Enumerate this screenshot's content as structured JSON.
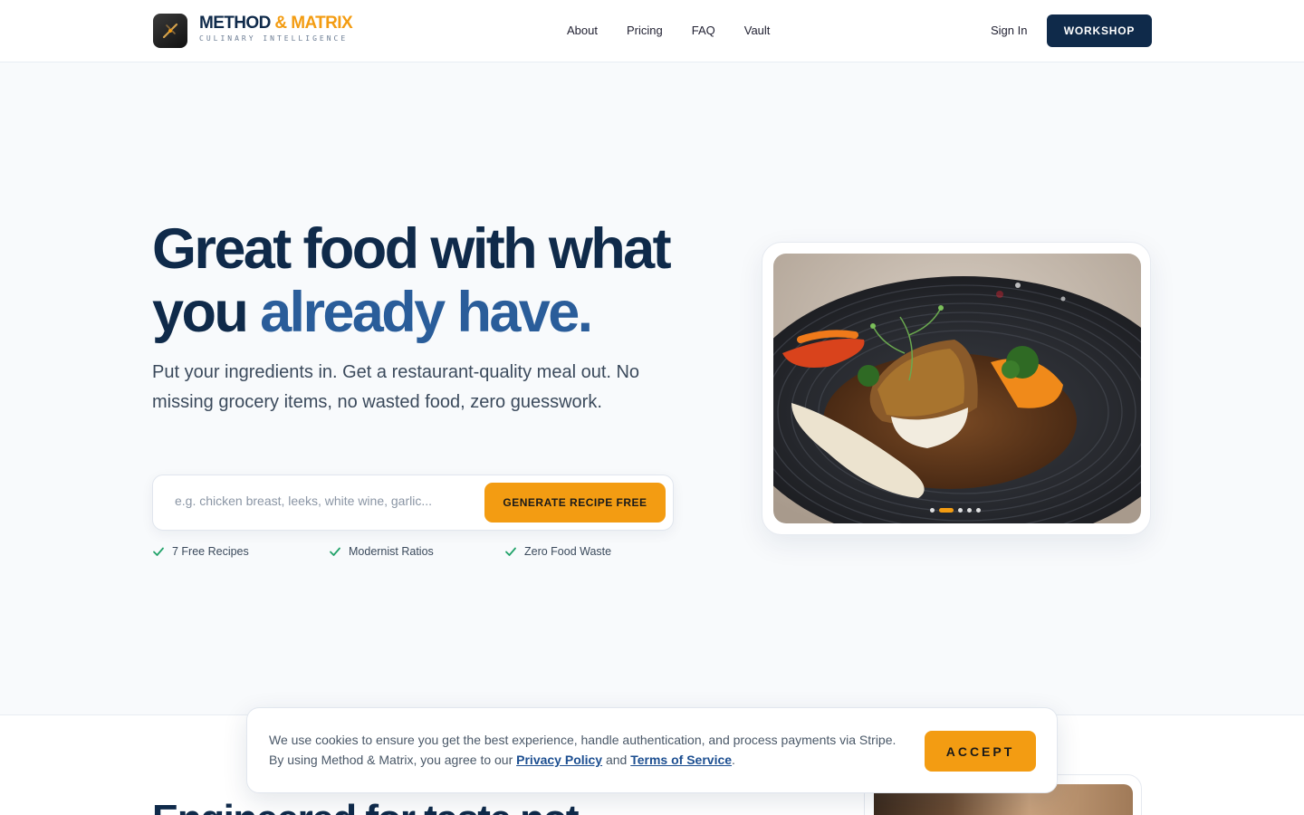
{
  "header": {
    "brand_name_main": "METHOD",
    "brand_name_amp": " & MATRIX",
    "brand_tagline": "CULINARY INTELLIGENCE",
    "nav": [
      "About",
      "Pricing",
      "FAQ",
      "Vault"
    ],
    "sign_in": "Sign In",
    "cta": "WORKSHOP"
  },
  "hero": {
    "title_line1": "Great food with what",
    "title_line2_a": "you ",
    "title_line2_b": "already have",
    "title_line2_c": ".",
    "subtitle": "Put your ingredients in. Get a restaurant-quality meal out. No missing grocery items, no wasted food, zero guesswork.",
    "search_placeholder": "e.g. chicken breast, leeks, white wine, garlic...",
    "generate_button": "GENERATE RECIPE FREE",
    "features": [
      "7 Free Recipes",
      "Modernist Ratios",
      "Zero Food Waste"
    ]
  },
  "carousel": {
    "slide_count": 5,
    "active_index": 1
  },
  "next_section": {
    "title_partial": "Engineered for taste not"
  },
  "cookie": {
    "text_before": "We use cookies to ensure you get the best experience, handle authentication, and process payments via Stripe. By using Method & Matrix, you agree to our ",
    "privacy_link": "Privacy Policy",
    "text_mid": " and ",
    "terms_link": "Terms of Service",
    "text_end": ".",
    "accept": "ACCEPT"
  },
  "colors": {
    "navy": "#0f2a4a",
    "accent_blue": "#2a5d9a",
    "orange": "#f39c12",
    "check_green": "#22a36a"
  }
}
